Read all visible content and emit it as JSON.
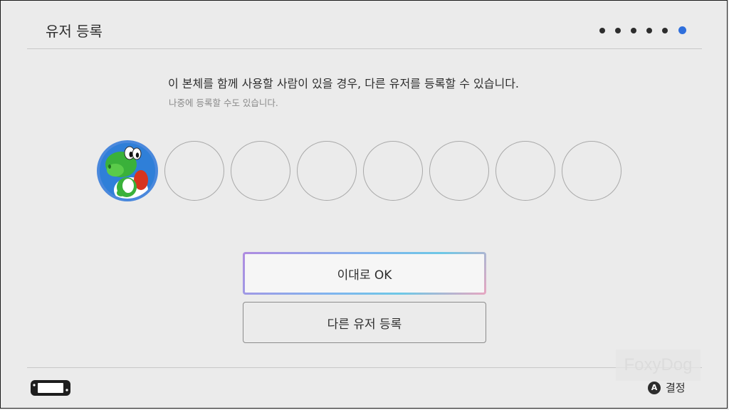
{
  "header": {
    "title": "유저 등록",
    "progress": {
      "total_steps": 6,
      "current_step": 6
    }
  },
  "description": {
    "main": "이 본체를 함께 사용할 사람이 있을 경우, 다른 유저를 등록할 수 있습니다.",
    "sub": "나중에 등록할 수도 있습니다."
  },
  "user_slots": [
    {
      "filled": true,
      "icon": "yoshi-avatar"
    },
    {
      "filled": false
    },
    {
      "filled": false
    },
    {
      "filled": false
    },
    {
      "filled": false
    },
    {
      "filled": false
    },
    {
      "filled": false
    },
    {
      "filled": false
    }
  ],
  "buttons": {
    "ok_label": "이대로 OK",
    "add_user_label": "다른 유저 등록"
  },
  "footer": {
    "console_icon": "switch-console-icon",
    "a_button": "A",
    "confirm_label": "결정",
    "watermark": "FoxyDog"
  },
  "colors": {
    "background": "#ebebeb",
    "accent": "#2f6fdc",
    "avatar_ring": "#4a88dc"
  }
}
